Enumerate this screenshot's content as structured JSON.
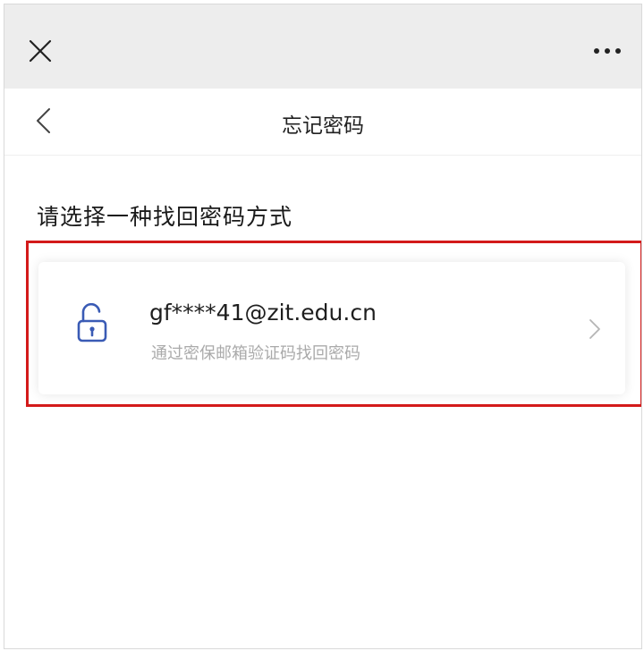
{
  "topbar": {
    "close_icon": "close-icon",
    "more_icon": "more-horizontal-icon"
  },
  "navbar": {
    "back_icon": "chevron-left-icon",
    "title": "忘记密码"
  },
  "main": {
    "section_title": "请选择一种找回密码方式",
    "options": [
      {
        "icon": "lock-icon",
        "email": "gf****41@zit.edu.cn",
        "description": "通过密保邮箱验证码找回密码",
        "chevron": "chevron-right-icon"
      }
    ]
  },
  "colors": {
    "topbar_bg": "#ededed",
    "highlight_border": "#d31a1a",
    "icon_blue": "#3a5bb5"
  }
}
